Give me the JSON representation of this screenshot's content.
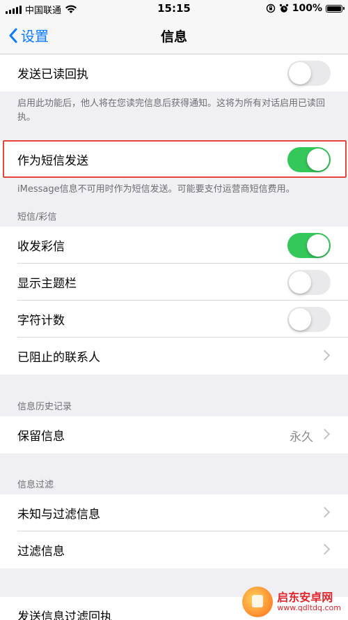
{
  "status_bar": {
    "carrier": "中国联通",
    "time": "15:15",
    "battery_percent": "100%",
    "battery_level": 1.0
  },
  "nav": {
    "back_label": "设置",
    "title": "信息"
  },
  "read_receipts": {
    "label": "发送已读回执",
    "enabled": false,
    "footer": "启用此功能后，他人将在您读完信息后获得通知。这将为所有对话启用已读回执。"
  },
  "send_as_sms": {
    "label": "作为短信发送",
    "enabled": true,
    "footer": "iMessage信息不可用时作为短信发送。可能要支付运营商短信费用。"
  },
  "sms_mms": {
    "header": "短信/彩信",
    "rows": [
      {
        "label": "收发彩信",
        "type": "toggle",
        "enabled": true
      },
      {
        "label": "显示主题栏",
        "type": "toggle",
        "enabled": false
      },
      {
        "label": "字符计数",
        "type": "toggle",
        "enabled": false
      },
      {
        "label": "已阻止的联系人",
        "type": "link"
      }
    ]
  },
  "message_history": {
    "header": "信息历史记录",
    "keep_messages_label": "保留信息",
    "keep_messages_value": "永久"
  },
  "message_filtering": {
    "header": "信息过滤",
    "rows": [
      {
        "label": "未知与过滤信息"
      },
      {
        "label": "过滤信息"
      }
    ]
  },
  "filter_receipts": {
    "label": "发送信息过滤回执"
  },
  "watermark": {
    "name": "启东安卓网",
    "url": "www.qdltdq.com"
  },
  "colors": {
    "accent": "#0a7aff",
    "toggle_on": "#34c759",
    "highlight": "#e5443b"
  }
}
